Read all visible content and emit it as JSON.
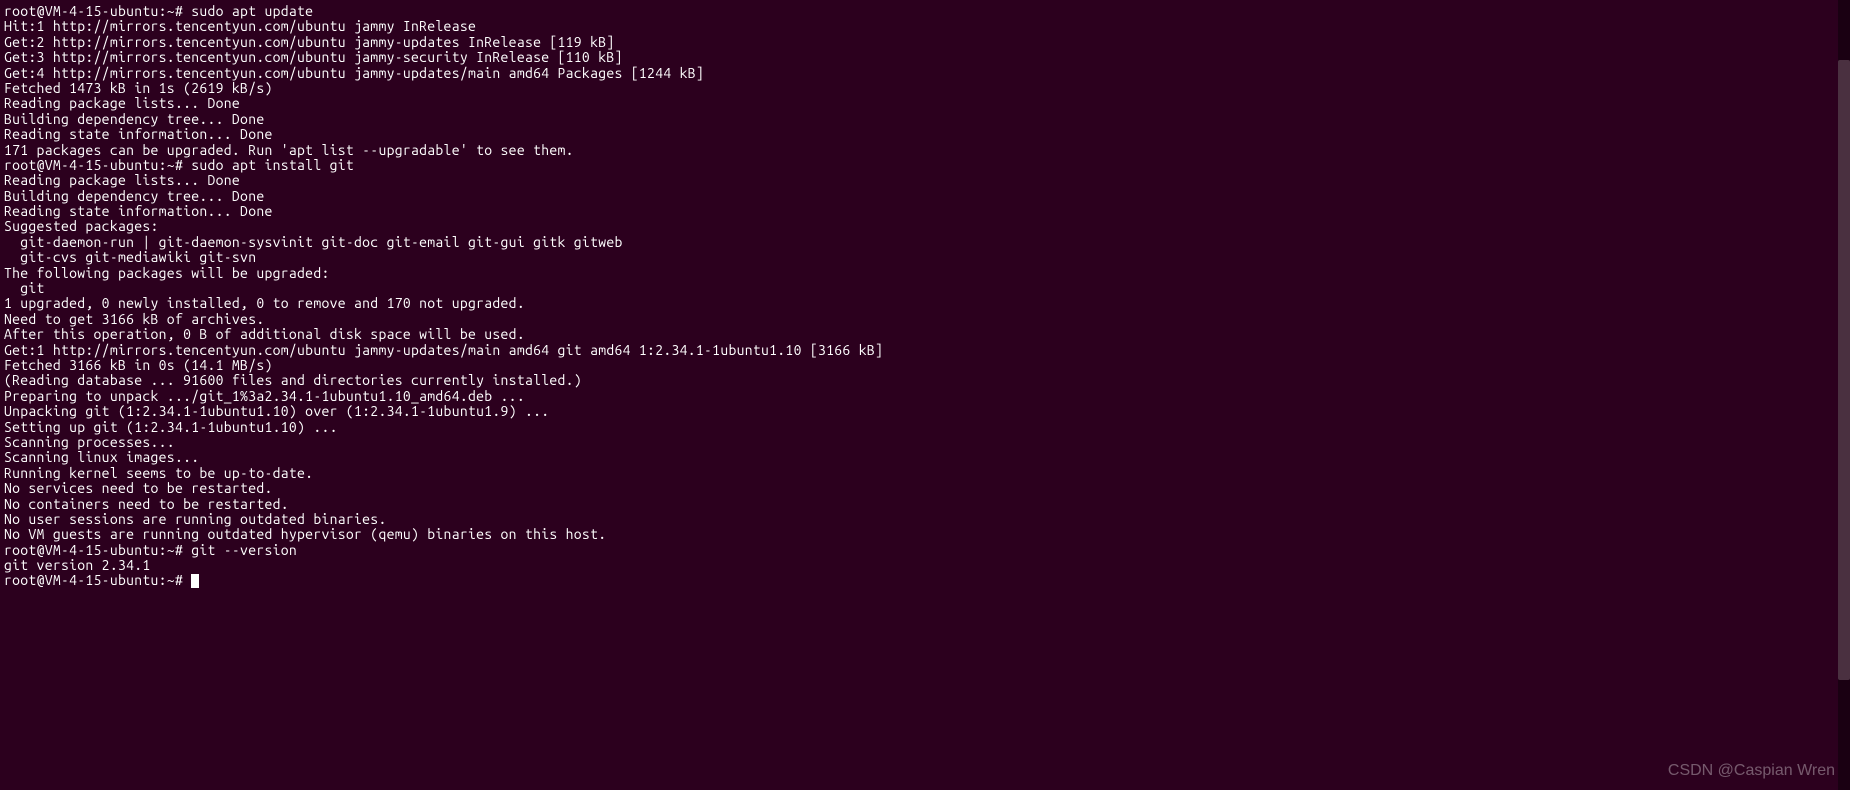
{
  "terminal": {
    "lines": [
      "root@VM-4-15-ubuntu:~# sudo apt update",
      "Hit:1 http://mirrors.tencentyun.com/ubuntu jammy InRelease",
      "Get:2 http://mirrors.tencentyun.com/ubuntu jammy-updates InRelease [119 kB]",
      "Get:3 http://mirrors.tencentyun.com/ubuntu jammy-security InRelease [110 kB]",
      "Get:4 http://mirrors.tencentyun.com/ubuntu jammy-updates/main amd64 Packages [1244 kB]",
      "Fetched 1473 kB in 1s (2619 kB/s)",
      "Reading package lists... Done",
      "Building dependency tree... Done",
      "Reading state information... Done",
      "171 packages can be upgraded. Run 'apt list --upgradable' to see them.",
      "root@VM-4-15-ubuntu:~# sudo apt install git",
      "Reading package lists... Done",
      "Building dependency tree... Done",
      "Reading state information... Done",
      "Suggested packages:",
      "  git-daemon-run | git-daemon-sysvinit git-doc git-email git-gui gitk gitweb",
      "  git-cvs git-mediawiki git-svn",
      "The following packages will be upgraded:",
      "  git",
      "1 upgraded, 0 newly installed, 0 to remove and 170 not upgraded.",
      "Need to get 3166 kB of archives.",
      "After this operation, 0 B of additional disk space will be used.",
      "Get:1 http://mirrors.tencentyun.com/ubuntu jammy-updates/main amd64 git amd64 1:2.34.1-1ubuntu1.10 [3166 kB]",
      "Fetched 3166 kB in 0s (14.1 MB/s)",
      "(Reading database ... 91600 files and directories currently installed.)",
      "Preparing to unpack .../git_1%3a2.34.1-1ubuntu1.10_amd64.deb ...",
      "Unpacking git (1:2.34.1-1ubuntu1.10) over (1:2.34.1-1ubuntu1.9) ...",
      "Setting up git (1:2.34.1-1ubuntu1.10) ...",
      "Scanning processes...",
      "Scanning linux images...",
      "",
      "Running kernel seems to be up-to-date.",
      "",
      "No services need to be restarted.",
      "",
      "No containers need to be restarted.",
      "",
      "No user sessions are running outdated binaries.",
      "",
      "No VM guests are running outdated hypervisor (qemu) binaries on this host.",
      "root@VM-4-15-ubuntu:~# git --version",
      "git version 2.34.1",
      "root@VM-4-15-ubuntu:~# "
    ]
  },
  "watermark": "CSDN @Caspian Wren"
}
